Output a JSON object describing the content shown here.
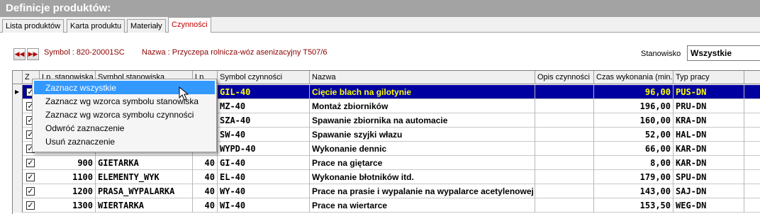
{
  "window": {
    "title": "Definicje produktów:"
  },
  "tabs": [
    {
      "label": "Lista produktów",
      "active": false
    },
    {
      "label": "Karta produktu",
      "active": false
    },
    {
      "label": "Materiały",
      "active": false
    },
    {
      "label": "Czynności",
      "active": true
    }
  ],
  "toolbar": {
    "prev_icon": "double-arrow-left-icon",
    "next_icon": "double-arrow-right-icon",
    "symbol_text": "Symbol : 820-20001SC",
    "name_text": "Nazwa : Przyczepa rolnicza-wóz asenizacyjny T507/6",
    "stanowisko_label": "Stanowisko",
    "stanowisko_value": "Wszystkie"
  },
  "grid": {
    "columns": [
      "Z",
      "Lp. stanowiska",
      "Symbol stanowiska",
      "Lp.",
      "Symbol czynności",
      "Nazwa",
      "Opis czynności",
      "Czas wykonania (min.)",
      "Typ pracy"
    ],
    "rows": [
      {
        "checked": true,
        "lp_st": "",
        "symbol_st": "",
        "lp": "",
        "symbol_cz": "GIL-40",
        "nazwa": "Cięcie blach na gilotynie",
        "opis": "",
        "czas": "96,00",
        "typ": "PUS-DN",
        "selected": true
      },
      {
        "checked": true,
        "lp_st": "",
        "symbol_st": "",
        "lp": "",
        "symbol_cz": "MZ-40",
        "nazwa": "Montaż zbiorników",
        "opis": "",
        "czas": "196,00",
        "typ": "PRU-DN",
        "selected": false
      },
      {
        "checked": true,
        "lp_st": "",
        "symbol_st": "",
        "lp": "",
        "symbol_cz": "SZA-40",
        "nazwa": "Spawanie zbiornika na automacie",
        "opis": "",
        "czas": "160,00",
        "typ": "KRA-DN",
        "selected": false
      },
      {
        "checked": true,
        "lp_st": "",
        "symbol_st": "",
        "lp": "",
        "symbol_cz": "SW-40",
        "nazwa": "Spawanie szyjki włazu",
        "opis": "",
        "czas": "52,00",
        "typ": "HAL-DN",
        "selected": false
      },
      {
        "checked": true,
        "lp_st": "",
        "symbol_st": "",
        "lp": "",
        "symbol_cz": "WYPD-40",
        "nazwa": "Wykonanie dennic",
        "opis": "",
        "czas": "66,00",
        "typ": "KAR-DN",
        "selected": false
      },
      {
        "checked": true,
        "lp_st": "900",
        "symbol_st": "GIETARKA",
        "lp": "40",
        "symbol_cz": "GI-40",
        "nazwa": "Prace na giętarce",
        "opis": "",
        "czas": "8,00",
        "typ": "KAR-DN",
        "selected": false
      },
      {
        "checked": true,
        "lp_st": "1100",
        "symbol_st": "ELEMENTY_WYK",
        "lp": "40",
        "symbol_cz": "EL-40",
        "nazwa": "Wykonanie błotników itd.",
        "opis": "",
        "czas": "179,00",
        "typ": "SPU-DN",
        "selected": false
      },
      {
        "checked": true,
        "lp_st": "1200",
        "symbol_st": "PRASA_WYPALARKA",
        "lp": "40",
        "symbol_cz": "WY-40",
        "nazwa": "Prace na prasie i wypalanie na wypalarce acetylenowej",
        "opis": "",
        "czas": "143,00",
        "typ": "SAJ-DN",
        "selected": false
      },
      {
        "checked": true,
        "lp_st": "1300",
        "symbol_st": "WIERTARKA",
        "lp": "40",
        "symbol_cz": "WI-40",
        "nazwa": "Prace na wiertarce",
        "opis": "",
        "czas": "153,50",
        "typ": "WEG-DN",
        "selected": false
      }
    ]
  },
  "context_menu": {
    "items": [
      {
        "label": "Zaznacz wszystkie",
        "highlighted": true
      },
      {
        "label": "Zaznacz wg wzorca symbolu stanowiska",
        "highlighted": false
      },
      {
        "label": "Zaznacz wg wzorca symbolu czynności",
        "highlighted": false
      },
      {
        "label": "Odwróć zaznaczenie",
        "highlighted": false
      },
      {
        "label": "Usuń zaznaczenie",
        "highlighted": false
      }
    ]
  },
  "colors": {
    "selection_bg": "#0000a0",
    "selection_text": "#ffff00",
    "menu_highlight": "#3399ff",
    "accent_red": "#c00000"
  }
}
